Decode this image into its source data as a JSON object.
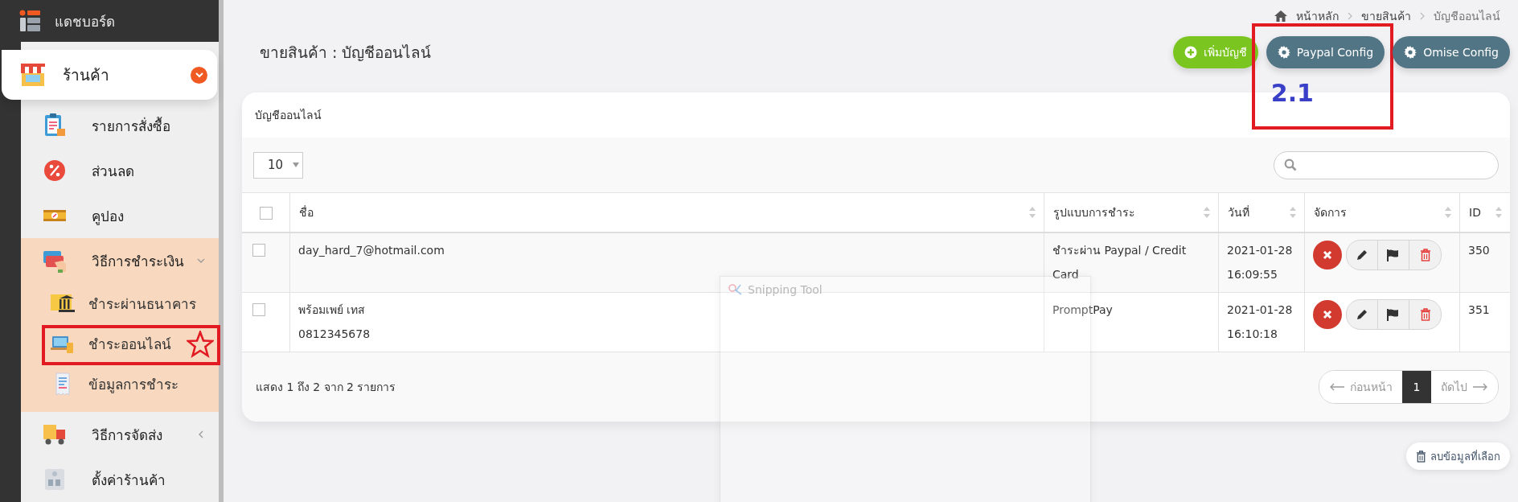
{
  "sidebar": {
    "brand": "แดชบอร์ด",
    "section": {
      "label": "ร้านค้า",
      "expanded": true
    },
    "items": [
      {
        "label": "รายการสั่งซื้อ",
        "kind": "link"
      },
      {
        "label": "ส่วนลด",
        "kind": "link"
      },
      {
        "label": "คูปอง",
        "kind": "link"
      },
      {
        "label": "วิธีการชำระเงิน",
        "kind": "group",
        "expanded": true,
        "children": [
          {
            "label": "ชำระผ่านธนาคาร",
            "annotated": false
          },
          {
            "label": "ชำระออนไลน์",
            "annotated": true
          },
          {
            "label": "ข้อมูลการชำระ",
            "annotated": false
          }
        ]
      },
      {
        "label": "วิธีการจัดส่ง",
        "kind": "group",
        "expanded": false
      },
      {
        "label": "ตั้งค่าร้านค้า",
        "kind": "link"
      }
    ]
  },
  "breadcrumb": [
    "หน้าหลัก",
    "ขายสินค้า",
    "บัญชีออนไลน์"
  ],
  "page_title": "ขายสินค้า : บัญชีออนไลน์",
  "buttons": [
    {
      "label": "เพิ่มบัญชี",
      "kind": "add"
    },
    {
      "label": "Paypal Config",
      "kind": "config",
      "callout": "2.1"
    },
    {
      "label": "Omise Config",
      "kind": "config"
    }
  ],
  "card": {
    "title": "บัญชีออนไลน์",
    "page_size": "10",
    "table": {
      "all_checked": false,
      "columns": [
        "ชื่อ",
        "รูปแบบการชำระ",
        "วันที่",
        "จัดการ",
        "ID"
      ],
      "rows": [
        {
          "checked": false,
          "name": [
            "day_hard_7@hotmail.com"
          ],
          "payment": "ชำระผ่าน Paypal / Credit Card",
          "date": "2021-01-28 16:09:55",
          "id": "350"
        },
        {
          "checked": false,
          "name": [
            "พร้อมเพย์ เทส",
            "0812345678"
          ],
          "payment": "PromptPay",
          "date": "2021-01-28 16:10:18",
          "id": "351"
        }
      ]
    },
    "info": "แสดง 1 ถึง 2 จาก 2 รายการ",
    "pagination": {
      "previous": {
        "label": "ก่อนหน้า",
        "disabled": true
      },
      "pages": [
        {
          "label": "1",
          "selected": true
        }
      ],
      "next": {
        "label": "ถัดไป",
        "disabled": true
      }
    }
  },
  "delete_selected": "ลบข้อมูลที่เลือก",
  "overlay": {
    "title": "Snipping Tool"
  }
}
